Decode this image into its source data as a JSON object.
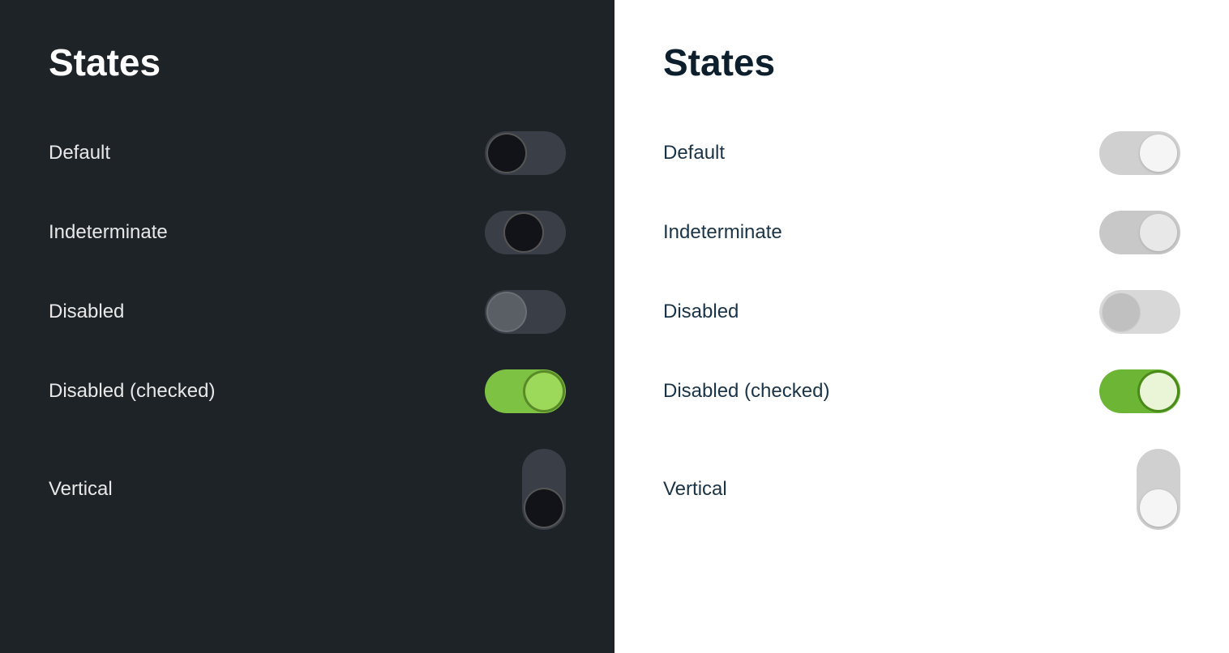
{
  "panels": [
    {
      "id": "dark",
      "theme": "dark",
      "title": "States",
      "states": [
        {
          "id": "default",
          "label": "Default"
        },
        {
          "id": "indeterminate",
          "label": "Indeterminate"
        },
        {
          "id": "disabled",
          "label": "Disabled"
        },
        {
          "id": "disabled-checked",
          "label": "Disabled (checked)"
        },
        {
          "id": "vertical",
          "label": "Vertical"
        }
      ]
    },
    {
      "id": "light",
      "theme": "light",
      "title": "States",
      "states": [
        {
          "id": "default",
          "label": "Default"
        },
        {
          "id": "indeterminate",
          "label": "Indeterminate"
        },
        {
          "id": "disabled",
          "label": "Disabled"
        },
        {
          "id": "disabled-checked",
          "label": "Disabled (checked)"
        },
        {
          "id": "vertical",
          "label": "Vertical"
        }
      ]
    }
  ]
}
